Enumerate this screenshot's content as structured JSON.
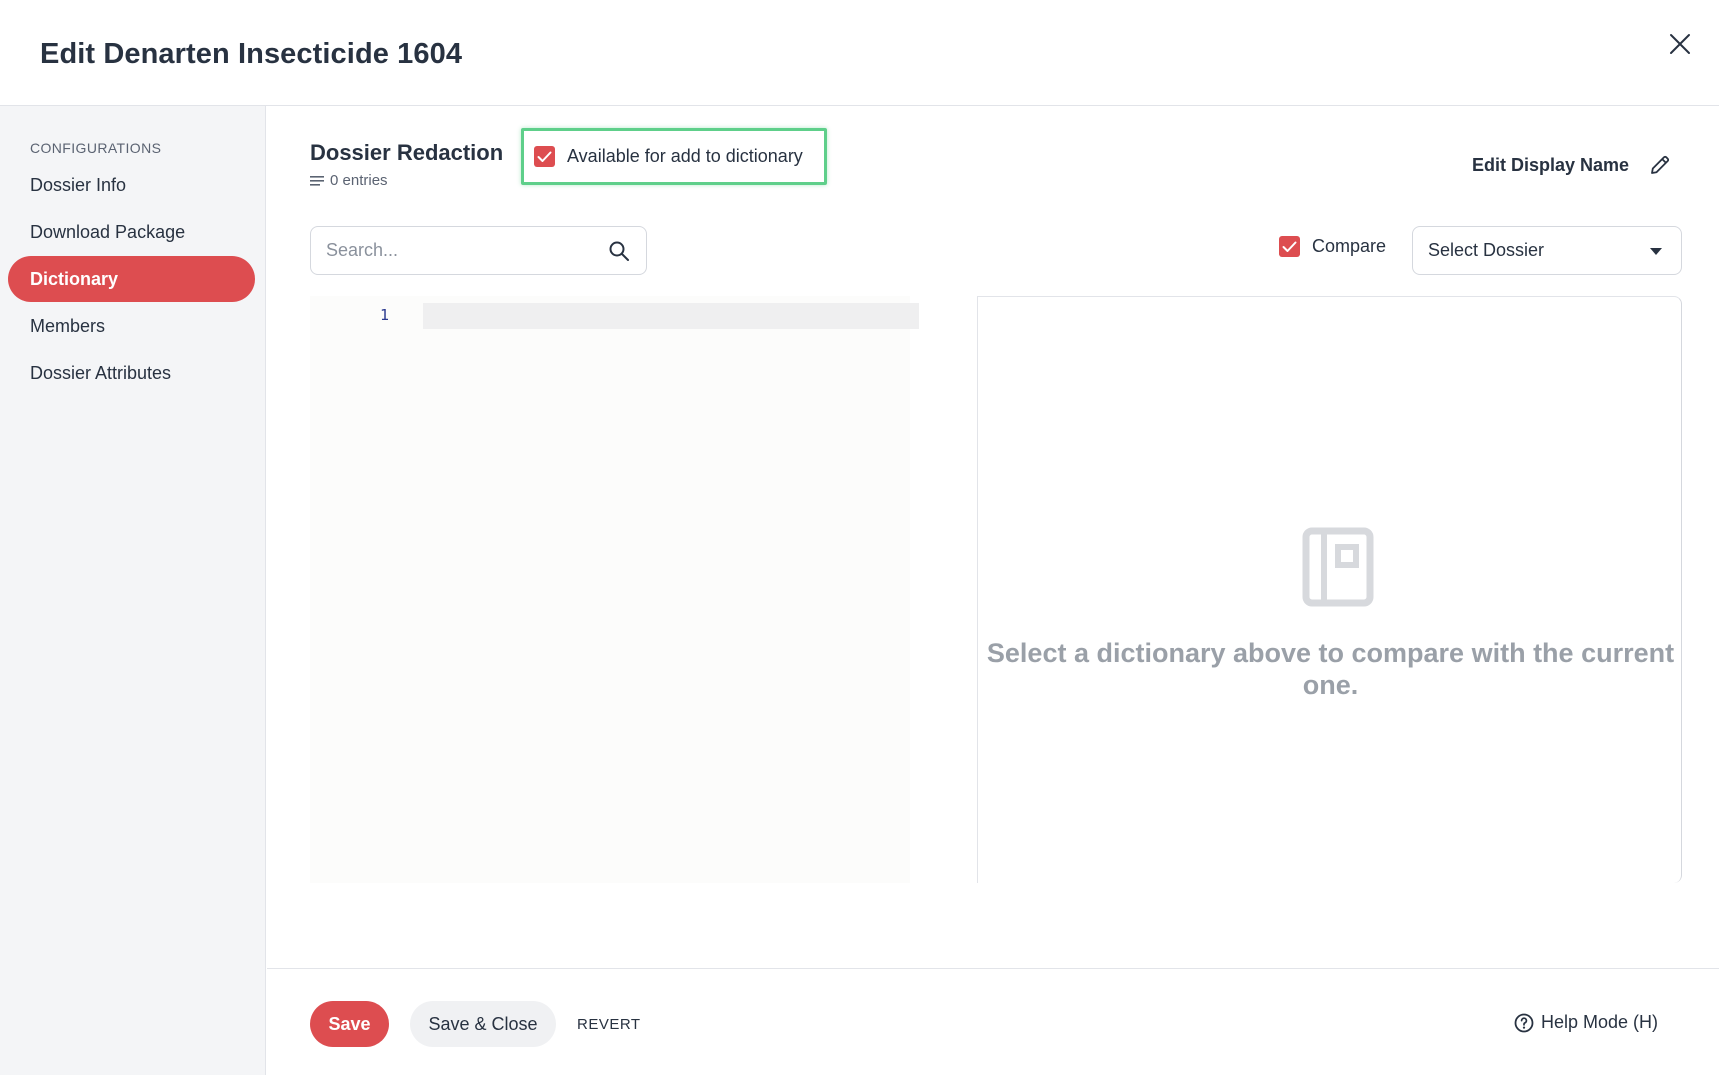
{
  "header": {
    "title": "Edit Denarten Insecticide 1604",
    "close_icon": "close-icon"
  },
  "sidebar": {
    "heading": "CONFIGURATIONS",
    "items": [
      {
        "label": "Dossier Info",
        "active": false
      },
      {
        "label": "Download Package",
        "active": false
      },
      {
        "label": "Dictionary",
        "active": true
      },
      {
        "label": "Members",
        "active": false
      },
      {
        "label": "Dossier Attributes",
        "active": false
      }
    ]
  },
  "main": {
    "dictionary_title": "Dossier Redaction",
    "entries_label": "0 entries",
    "available_checkbox": {
      "label": "Available for add to dictionary",
      "checked": true
    },
    "edit_display_name_label": "Edit Display Name",
    "search": {
      "placeholder": "Search...",
      "value": ""
    },
    "compare": {
      "label": "Compare",
      "checked": true
    },
    "select_dossier": {
      "selected": "Select Dossier"
    },
    "editor": {
      "line_numbers": [
        "1"
      ]
    },
    "compare_panel": {
      "empty_message": "Select a dictionary above to compare with the current one."
    }
  },
  "footer": {
    "save_label": "Save",
    "save_close_label": "Save & Close",
    "revert_label": "REVERT",
    "help_label": "Help Mode (H)"
  },
  "colors": {
    "accent": "#dd4d50",
    "highlight_border": "#5ecf8a",
    "text": "#283241",
    "muted": "#9aa0a8"
  }
}
